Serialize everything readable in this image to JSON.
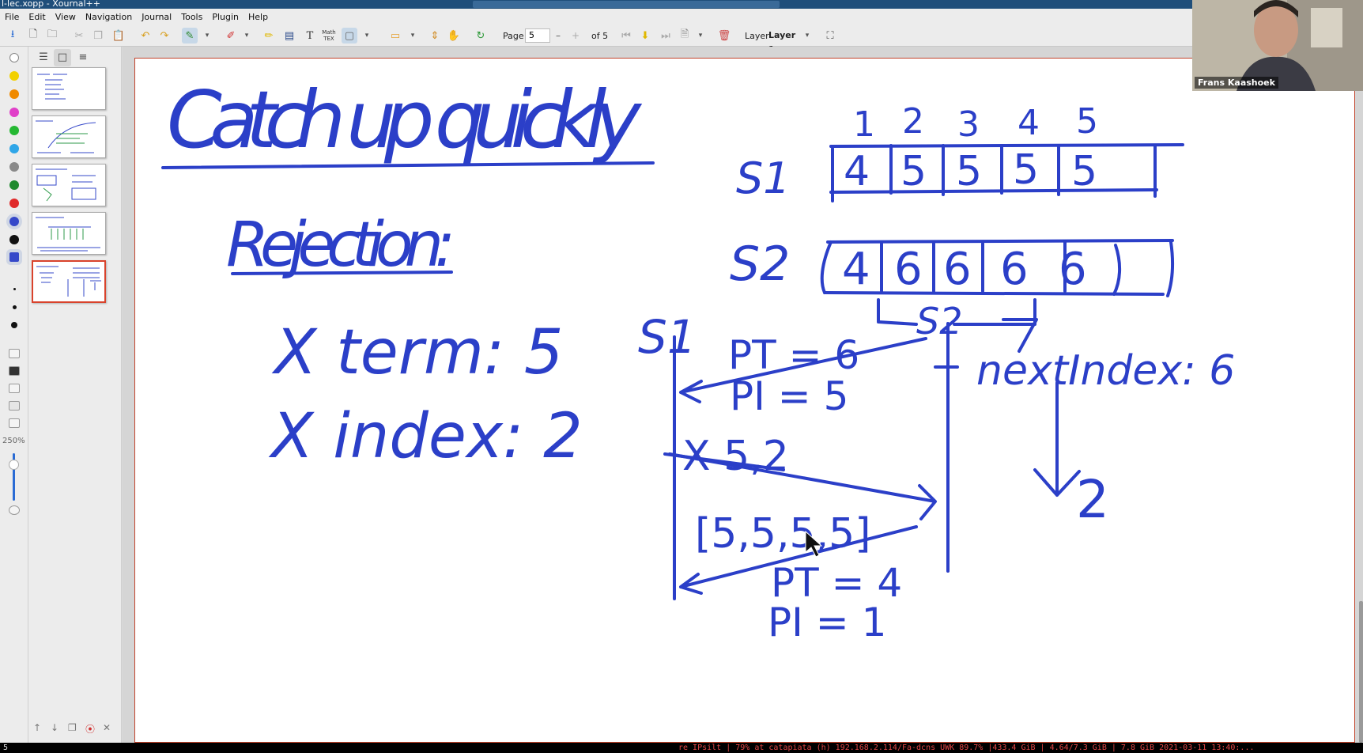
{
  "window": {
    "title": "l-lec.xopp - Xournal++"
  },
  "menu": [
    "File",
    "Edit",
    "View",
    "Navigation",
    "Journal",
    "Tools",
    "Plugin",
    "Help"
  ],
  "toolbar": {
    "page_label": "Page",
    "page_value": "5",
    "page_total": "of 5",
    "page_minus": "–",
    "page_plus": "+",
    "layer_label": "Layer",
    "layer_value": "Layer 1",
    "math_tex_label": "Math\nTEX"
  },
  "palette": {
    "colors": [
      "#ffffff",
      "#f2d100",
      "#f08a00",
      "#e040c8",
      "#25b832",
      "#2fa6e8",
      "#8a8a8a",
      "#1f8a2e",
      "#e02a2a",
      "#3548c9",
      "#111111",
      "#3548c9"
    ],
    "zoom_label": "250%"
  },
  "video": {
    "name": "Frans Kaashoek"
  },
  "status": {
    "left": "5",
    "right": "re IPsilt | 79% at catapiata (h) 192.168.2.114/Fa-dcns UWK 89.7% |433.4 GiB | 4.64/7.3 GiB | 7.8 GiB 2021-03-11 13:40:..."
  },
  "ink": {
    "title": "Catch up quickly",
    "rejection_heading": "Rejection:",
    "term_line": "X term: 5",
    "index_line": "X index: 2",
    "column_numbers": [
      "1",
      "2",
      "3",
      "4",
      "5"
    ],
    "s1_label": "S1",
    "s1_log": [
      "4",
      "5",
      "5",
      "5",
      "5"
    ],
    "s2_label": "S2",
    "s2_log": [
      "4",
      "6",
      "6",
      "6",
      "6"
    ],
    "s2_underlabel": "S2",
    "s2_lower_label": "S2",
    "next_index_label": "nextIndex: 6",
    "seven": "7",
    "down_to": "2",
    "lower_s1_label": "S1",
    "pt_6": "PT = 6",
    "pi_5": "PI = 5",
    "x52": "X 5,2",
    "entries": "[5,5,5,5]",
    "pt_4": "PT = 4",
    "pi_1": "PI = 1"
  }
}
